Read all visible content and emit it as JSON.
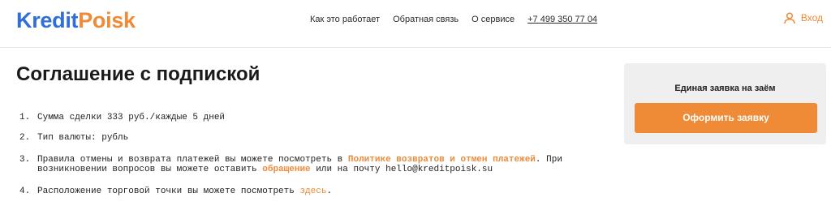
{
  "header": {
    "logo_part_a": "Kredit",
    "logo_part_b": "Poisk",
    "nav": [
      {
        "label": "Как это работает"
      },
      {
        "label": "Обратная связь"
      },
      {
        "label": "О сервисе"
      },
      {
        "label": "+7 499 350 77 04"
      }
    ],
    "login_label": "Вход",
    "login_icon": "user-icon"
  },
  "main": {
    "title": "Соглашение с подпиской",
    "terms": [
      {
        "num": "1.",
        "text": "Сумма сделки 333 руб./каждые 5 дней"
      },
      {
        "num": "2.",
        "text": "Тип валюты: рубль"
      },
      {
        "num": "3.",
        "text_before": "Правила отмены и возврата платежей вы можете посмотреть в ",
        "link1": "Политике возвратов и отмен платежей",
        "text_middle": ". При возникновении вопросов вы можете оставить ",
        "link2": "обращение",
        "text_after": " или на почту hello@kreditpoisk.su"
      },
      {
        "num": "4.",
        "text_before": "Расположение торговой точки вы можете посмотреть ",
        "link": "здесь",
        "text_after": "."
      }
    ]
  },
  "sidebar_card": {
    "title": "Единая заявка на заём",
    "button_label": "Оформить заявку"
  },
  "colors": {
    "brand_blue": "#2f6fd6",
    "accent_orange": "#ef8a37",
    "card_bg": "#efefef"
  }
}
